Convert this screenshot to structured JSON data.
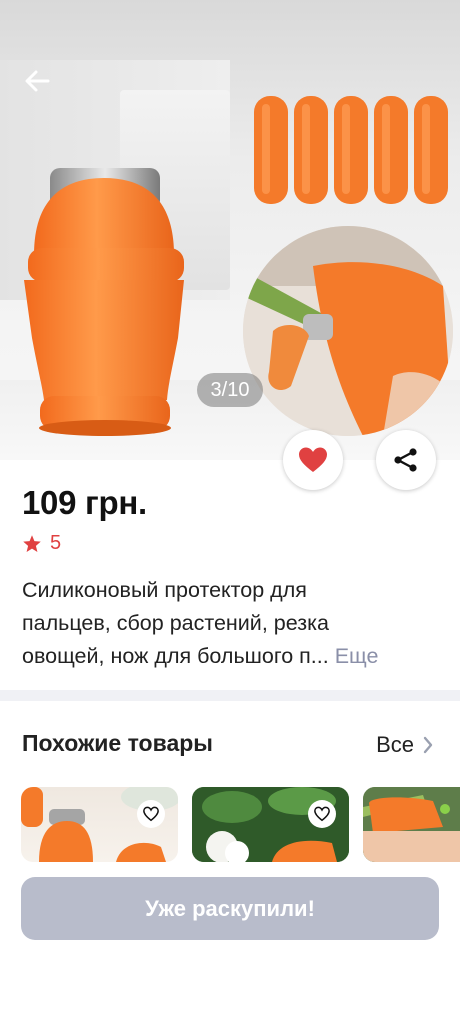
{
  "gallery": {
    "counter": "3/10",
    "image_count": 10,
    "current_index": 3
  },
  "product": {
    "price": "109 грн.",
    "rating": "5",
    "description_lines": [
      "Силиконовый протектор для",
      "пальцев, сбор растений, резка",
      "овощей, нож для большого п..."
    ],
    "more_label": "Еще"
  },
  "similar": {
    "title": "Похожие товары",
    "all_label": "Все"
  },
  "buy_button": {
    "label": "Уже раскупили!"
  },
  "colors": {
    "accent_red": "#e04141",
    "more_link": "#8a8fa8",
    "disabled_button": "#b8bccb",
    "product_orange": "#f47a2a"
  },
  "icons": {
    "back": "arrow-left-icon",
    "like": "heart-icon",
    "share": "share-icon",
    "rating": "star-icon",
    "all": "chevron-right-icon",
    "favorite": "heart-outline-icon"
  }
}
